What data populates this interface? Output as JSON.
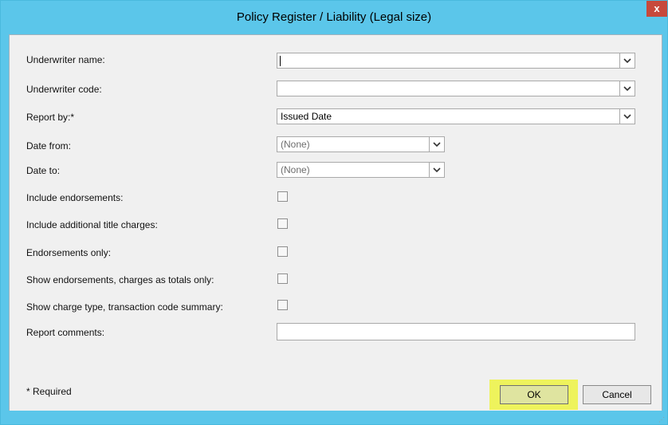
{
  "window": {
    "title": "Policy Register / Liability (Legal size)",
    "close_glyph": "x"
  },
  "form": {
    "underwriter_name": {
      "label": "Underwriter name:",
      "value": ""
    },
    "underwriter_code": {
      "label": "Underwriter code:",
      "value": ""
    },
    "report_by": {
      "label": "Report by:*",
      "value": "Issued Date"
    },
    "date_from": {
      "label": "Date from:",
      "value": "(None)"
    },
    "date_to": {
      "label": "Date to:",
      "value": "(None)"
    },
    "include_endorsements": {
      "label": "Include endorsements:",
      "checked": false
    },
    "include_additional_title_charges": {
      "label": "Include additional title charges:",
      "checked": false
    },
    "endorsements_only": {
      "label": "Endorsements only:",
      "checked": false
    },
    "show_totals_only": {
      "label": "Show endorsements, charges as totals only:",
      "checked": false
    },
    "show_charge_summary": {
      "label": "Show charge type, transaction code summary:",
      "checked": false
    },
    "report_comments": {
      "label": "Report comments:",
      "value": ""
    }
  },
  "footer": {
    "required_note": "* Required",
    "ok_label": "OK",
    "cancel_label": "Cancel"
  },
  "icons": {
    "dropdown": "chevron-down-icon",
    "close": "close-icon"
  },
  "colors": {
    "titlebar": "#5bc6ea",
    "close_button": "#c7493c",
    "ok_highlight": "#eef35c"
  }
}
